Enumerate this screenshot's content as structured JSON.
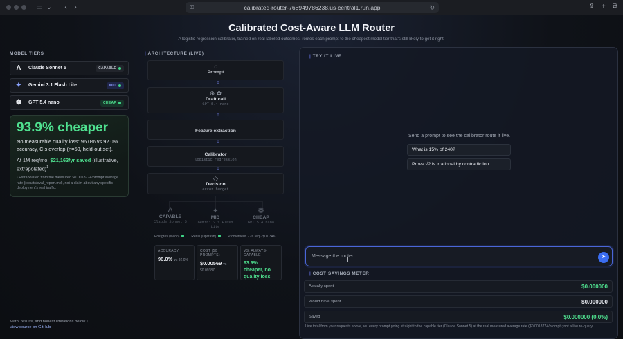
{
  "browser": {
    "url": "calibrated-router-768949786238.us-central1.run.app"
  },
  "header": {
    "title": "Calibrated Cost-Aware LLM Router",
    "subtitle": "A logistic-regression calibrator, trained on real labeled outcomes, routes each prompt to the cheapest model tier that's still likely to get it right."
  },
  "tiers": {
    "title": "MODEL TIERS",
    "items": [
      {
        "name": "Claude Sonnet 5",
        "badge": "CAPABLE",
        "color": "#c9ccd3",
        "icon": "anthropic-icon"
      },
      {
        "name": "Gemini 3.1 Flash Lite",
        "badge": "MID",
        "color": "#7f8fff",
        "icon": "gemini-icon"
      },
      {
        "name": "GPT 5.4 nano",
        "badge": "CHEAP",
        "color": "#4fe08f",
        "icon": "openai-icon"
      }
    ]
  },
  "savings_card": {
    "headline": "93.9% cheaper",
    "quality": "No measurable quality loss: 96.0% vs 92.0% accuracy, CIs overlap (n=50, held-out set).",
    "scale_prefix": "At 1M req/mo:",
    "scale_value": "$21,163/yr saved",
    "scale_suffix": "(illustrative, extrapolated)",
    "footnote": "¹ Extrapolated from the measured $0.0018774/prompt average rate (results/eval_report.md), not a claim about any specific deployment's real traffic."
  },
  "footer": {
    "text": "Math, results, and honest limitations below ↓",
    "link": "View source on GitHub"
  },
  "architecture": {
    "title": "ARCHITECTURE (LIVE)",
    "nodes": [
      {
        "title": "Prompt",
        "sub": ""
      },
      {
        "title": "Draft call",
        "sub": "GPT 5.4 nano"
      },
      {
        "title": "Feature extraction",
        "sub": ""
      },
      {
        "title": "Calibrator",
        "sub": "logistic regression"
      },
      {
        "title": "Decision",
        "sub": "error budget"
      }
    ],
    "tiers": [
      {
        "title": "CAPABLE",
        "sub": "Claude Sonnet 5"
      },
      {
        "title": "MID",
        "sub": "Gemini 3.1 Flash Lite"
      },
      {
        "title": "CHEAP",
        "sub": "GPT 5.4 nano"
      }
    ],
    "infra": [
      "Postgres (Neon)",
      "Redis (Upstash)",
      "Prometheus · 26 req · $0.0346"
    ],
    "stats": {
      "accuracy_label": "ACCURACY",
      "accuracy_value": "96.0%",
      "accuracy_vs": "vs 92.0%",
      "cost_label": "COST (50 PROMPTS)",
      "cost_value": "$0.00569",
      "cost_vs": "vs $0.09387",
      "vs_label": "VS. ALWAYS-CAPABLE",
      "vs_value": "93.9% cheaper, no quality loss"
    }
  },
  "try_it": {
    "title": "TRY IT LIVE",
    "hint": "Send a prompt to see the calibrator route it live.",
    "examples": [
      "What is 15% of 240?",
      "Prove √2 is irrational by contradiction"
    ],
    "placeholder": "Message the router..."
  },
  "meter": {
    "title": "COST SAVINGS METER",
    "rows": [
      {
        "label": "Actually spent",
        "value": "$0.000000"
      },
      {
        "label": "Would have spent",
        "value": "$0.000000"
      },
      {
        "label": "Saved",
        "value": "$0.000000 (0.0%)"
      }
    ],
    "note": "Live total from your requests above, vs. every prompt going straight to the capable tier (Claude Sonnet 5) at the real measured average rate ($0.0018774/prompt); not a live re-query."
  }
}
